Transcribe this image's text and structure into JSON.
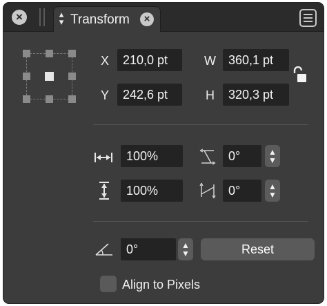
{
  "tabbar": {
    "tab_title": "Transform",
    "tab_chevron_icon": "chevron-up-down-icon",
    "close_icon": "close-icon",
    "menu_icon": "hamburger-menu-icon"
  },
  "position": {
    "x_label": "X",
    "x_value": "210,0 pt",
    "y_label": "Y",
    "y_value": "242,6 pt"
  },
  "size": {
    "w_label": "W",
    "w_value": "360,1 pt",
    "h_label": "H",
    "h_value": "320,3 pt",
    "lock_icon": "unlocked-padlock-icon"
  },
  "scale": {
    "horizontal_value": "100%",
    "vertical_value": "100%"
  },
  "shear": {
    "horizontal_value": "0°",
    "vertical_value": "0°"
  },
  "rotation": {
    "value": "0°",
    "reset_label": "Reset"
  },
  "options": {
    "align_to_pixels_label": "Align to Pixels",
    "align_to_pixels_checked": false
  },
  "colors": {
    "panel_bg": "#3c3c3c",
    "tabbar_bg": "#2b2b2b",
    "field_bg": "#232323",
    "button_bg": "#5a5a5a"
  }
}
